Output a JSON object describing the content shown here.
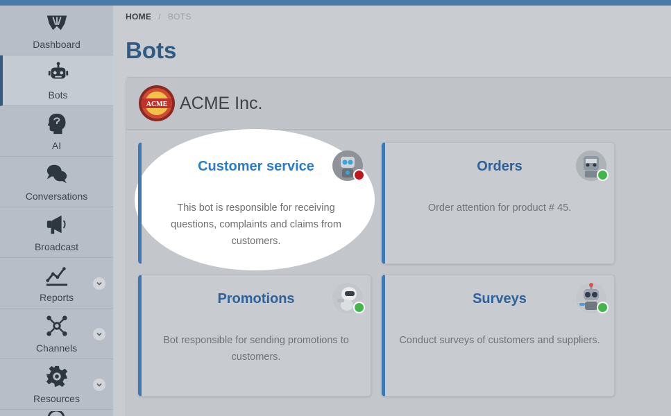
{
  "sidebar": {
    "items": [
      {
        "label": "Dashboard",
        "icon": "dashboard-icon"
      },
      {
        "label": "Bots",
        "icon": "bot-icon"
      },
      {
        "label": "AI",
        "icon": "ai-head-icon"
      },
      {
        "label": "Conversations",
        "icon": "chat-bubbles-icon"
      },
      {
        "label": "Broadcast",
        "icon": "megaphone-icon"
      },
      {
        "label": "Reports",
        "icon": "chart-icon"
      },
      {
        "label": "Channels",
        "icon": "channels-icon"
      },
      {
        "label": "Resources",
        "icon": "gear-icon"
      }
    ]
  },
  "breadcrumb": {
    "home": "HOME",
    "separator": "/",
    "current": "BOTS"
  },
  "page": {
    "title": "Bots"
  },
  "organization": {
    "name": "ACME Inc.",
    "logo_text": "ACME"
  },
  "bots": [
    {
      "name": "Customer service",
      "description": "This bot is responsible for receiving questions, complaints and claims from customers.",
      "status_color": "#c0161d"
    },
    {
      "name": "Orders",
      "description": "Order attention for product # 45.",
      "status_color": "#43b649"
    },
    {
      "name": "Promotions",
      "description": "Bot responsible for sending promotions to customers.",
      "status_color": "#43b649"
    },
    {
      "name": "Surveys",
      "description": "Conduct surveys of customers and suppliers.",
      "status_color": "#43b649"
    }
  ],
  "colors": {
    "accent": "#2f5a83",
    "card_border": "#3d7ab4",
    "status_offline": "#c0161d",
    "status_online": "#43b649"
  }
}
